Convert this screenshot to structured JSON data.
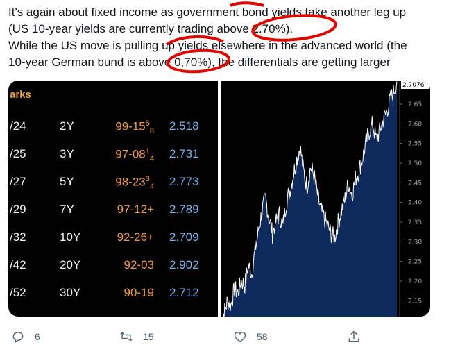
{
  "tweet": {
    "line1": "It's again about fixed income as government bond yields take another leg up",
    "line2": "(US 10-year yields are currently trading above 2.70%).",
    "line3": "While the US move is pulling up yields elsewhere in the advanced world (the",
    "line4": "10-year German bund is above 0,70%), the differentials are getting larger"
  },
  "table": {
    "title": "arks",
    "rows": [
      {
        "year": "/24",
        "tenor": "2Y",
        "price_main": "99-15",
        "price_sup": "5",
        "price_sub": "8",
        "yield": "2.518"
      },
      {
        "year": "/25",
        "tenor": "3Y",
        "price_main": "97-08",
        "price_sup": "1",
        "price_sub": "4",
        "yield": "2.731"
      },
      {
        "year": "/27",
        "tenor": "5Y",
        "price_main": "98-23",
        "price_sup": "3",
        "price_sub": "4",
        "yield": "2.773"
      },
      {
        "year": "/29",
        "tenor": "7Y",
        "price_main": "97-12+",
        "price_sup": "",
        "price_sub": "",
        "yield": "2.789"
      },
      {
        "year": "/32",
        "tenor": "10Y",
        "price_main": "92-26+",
        "price_sup": "",
        "price_sub": "",
        "yield": "2.709"
      },
      {
        "year": "/42",
        "tenor": "20Y",
        "price_main": "92-03",
        "price_sup": "",
        "price_sub": "",
        "yield": "2.902"
      },
      {
        "year": "/52",
        "tenor": "30Y",
        "price_main": "90-19",
        "price_sup": "",
        "price_sub": "",
        "yield": "2.712"
      }
    ]
  },
  "chart_data": {
    "type": "area",
    "title": "",
    "xlabel": "",
    "ylabel": "",
    "ylim": [
      2.11,
      2.71
    ],
    "yticks": [
      "2.65",
      "2.60",
      "2.55",
      "2.50",
      "2.45",
      "2.40",
      "2.35",
      "2.30",
      "2.25",
      "2.20",
      "2.15"
    ],
    "last_value_label": "2.7076",
    "series": [
      {
        "values": [
          2.1,
          2.12,
          2.15,
          2.14,
          2.18,
          2.17,
          2.2,
          2.19,
          2.24,
          2.22,
          2.28,
          2.33,
          2.38,
          2.41,
          2.36,
          2.32,
          2.35,
          2.37,
          2.34,
          2.4,
          2.43,
          2.47,
          2.51,
          2.54,
          2.48,
          2.44,
          2.49,
          2.47,
          2.42,
          2.38,
          2.36,
          2.34,
          2.32,
          2.31,
          2.35,
          2.38,
          2.41,
          2.45,
          2.42,
          2.46,
          2.48,
          2.51,
          2.55,
          2.58,
          2.6,
          2.56,
          2.58,
          2.61,
          2.63,
          2.66,
          2.68,
          2.7076
        ]
      }
    ],
    "colors": {
      "fill": "#0f2a5c",
      "line": "#ffffff",
      "highlight": "#e10600"
    }
  },
  "actions": {
    "reply_count": "6",
    "retweet_count": "15",
    "like_count": "58",
    "share_label": ""
  }
}
